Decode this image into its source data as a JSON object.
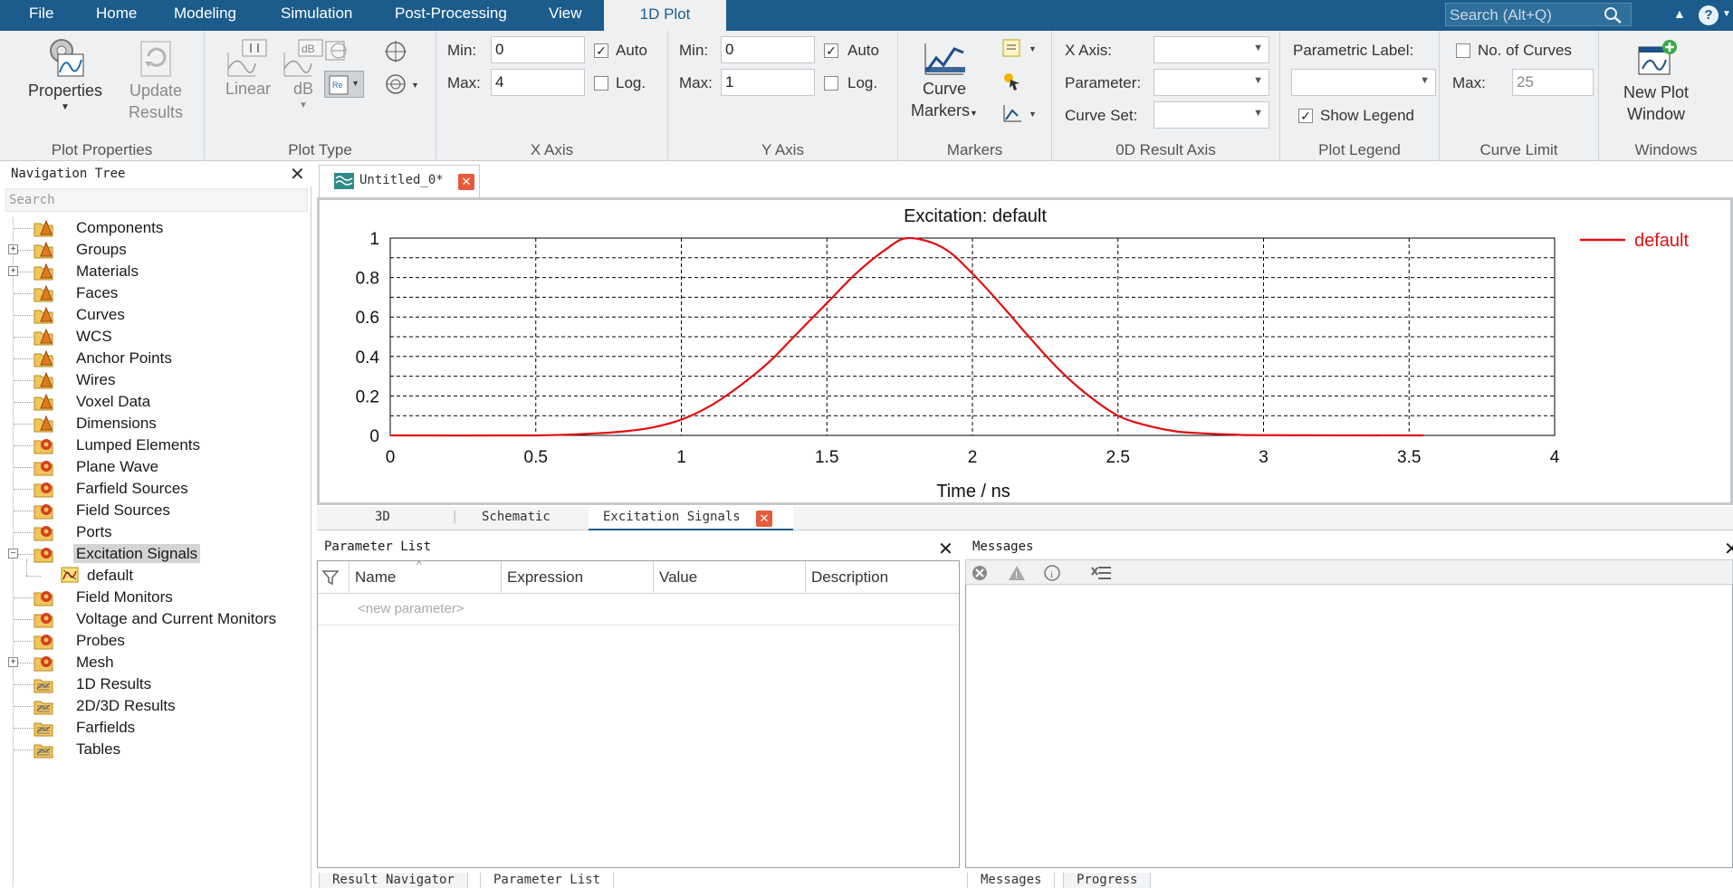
{
  "menu": {
    "tabs": [
      {
        "label": "File"
      },
      {
        "label": "Home"
      },
      {
        "label": "Modeling"
      },
      {
        "label": "Simulation"
      },
      {
        "label": "Post-Processing"
      },
      {
        "label": "View"
      },
      {
        "label": "1D Plot"
      }
    ],
    "active_tab": "1D Plot",
    "search_placeholder": "Search (Alt+Q)"
  },
  "ribbon": {
    "plot_properties": {
      "label": "Plot Properties",
      "properties_button": "Properties",
      "update_results_button_line1": "Update",
      "update_results_button_line2": "Results"
    },
    "plot_type": {
      "label": "Plot Type",
      "linear": "Linear",
      "db": "dB"
    },
    "x_axis": {
      "label": "X Axis",
      "min_label": "Min:",
      "min_value": "0",
      "max_label": "Max:",
      "max_value": "4",
      "auto_label": "Auto",
      "auto_checked": true,
      "log_label": "Log.",
      "log_checked": false
    },
    "y_axis": {
      "label": "Y Axis",
      "min_label": "Min:",
      "min_value": "0",
      "max_label": "Max:",
      "max_value": "1",
      "auto_label": "Auto",
      "auto_checked": true,
      "log_label": "Log.",
      "log_checked": false
    },
    "markers": {
      "label": "Markers",
      "curve_markers_line1": "Curve",
      "curve_markers_line2": "Markers"
    },
    "result_axis": {
      "label": "0D Result Axis",
      "x_axis_label": "X Axis:",
      "parameter_label": "Parameter:",
      "curve_set_label": "Curve Set:"
    },
    "plot_legend": {
      "label": "Plot Legend",
      "parametric_label": "Parametric Label:",
      "show_legend_label": "Show Legend",
      "show_legend_checked": true
    },
    "curve_limit": {
      "label": "Curve Limit",
      "no_of_curves_label": "No. of Curves",
      "no_of_curves_checked": false,
      "max_label": "Max:",
      "max_value": "25"
    },
    "windows": {
      "label": "Windows",
      "new_plot_window_line1": "New Plot",
      "new_plot_window_line2": "Window"
    }
  },
  "nav": {
    "title": "Navigation Tree",
    "search_placeholder": "Search",
    "items": [
      {
        "label": "Components",
        "expandable": false,
        "icon": "folder-cone-icon"
      },
      {
        "label": "Groups",
        "expandable": true,
        "icon": "folder-cone-icon"
      },
      {
        "label": "Materials",
        "expandable": true,
        "icon": "folder-cone-icon"
      },
      {
        "label": "Faces",
        "expandable": false,
        "icon": "folder-cone-icon"
      },
      {
        "label": "Curves",
        "expandable": false,
        "icon": "folder-cone-icon"
      },
      {
        "label": "WCS",
        "expandable": false,
        "icon": "folder-cone-icon"
      },
      {
        "label": "Anchor Points",
        "expandable": false,
        "icon": "folder-cone-icon"
      },
      {
        "label": "Wires",
        "expandable": false,
        "icon": "folder-cone-icon"
      },
      {
        "label": "Voxel Data",
        "expandable": false,
        "icon": "folder-cone-icon"
      },
      {
        "label": "Dimensions",
        "expandable": false,
        "icon": "folder-cone-icon"
      },
      {
        "label": "Lumped Elements",
        "expandable": false,
        "icon": "folder-gear-icon"
      },
      {
        "label": "Plane Wave",
        "expandable": false,
        "icon": "folder-gear-icon"
      },
      {
        "label": "Farfield Sources",
        "expandable": false,
        "icon": "folder-gear-icon"
      },
      {
        "label": "Field Sources",
        "expandable": false,
        "icon": "folder-gear-icon"
      },
      {
        "label": "Ports",
        "expandable": false,
        "icon": "folder-gear-icon"
      },
      {
        "label": "Excitation Signals",
        "expandable": true,
        "expanded": true,
        "selected": true,
        "icon": "folder-gear-icon"
      },
      {
        "label": "default",
        "child": true,
        "icon": "signal-icon"
      },
      {
        "label": "Field Monitors",
        "expandable": false,
        "icon": "folder-gear-icon"
      },
      {
        "label": "Voltage and Current Monitors",
        "expandable": false,
        "icon": "folder-gear-icon"
      },
      {
        "label": "Probes",
        "expandable": false,
        "icon": "folder-gear-icon"
      },
      {
        "label": "Mesh",
        "expandable": true,
        "icon": "folder-gear-icon"
      },
      {
        "label": "1D Results",
        "expandable": false,
        "icon": "folder-results-icon"
      },
      {
        "label": "2D/3D Results",
        "expandable": false,
        "icon": "folder-results-icon"
      },
      {
        "label": "Farfields",
        "expandable": false,
        "icon": "folder-results-icon"
      },
      {
        "label": "Tables",
        "expandable": false,
        "icon": "folder-results-icon"
      }
    ]
  },
  "document": {
    "tab_title": "Untitled_0*"
  },
  "chart_data": {
    "type": "line",
    "title": "Excitation: default",
    "xlabel": "Time / ns",
    "ylabel": "",
    "xlim": [
      0,
      4
    ],
    "ylim": [
      0,
      1
    ],
    "x_ticks": [
      "0",
      "0.5",
      "1",
      "1.5",
      "2",
      "2.5",
      "3",
      "3.5",
      "4"
    ],
    "y_ticks": [
      "0",
      "0.2",
      "0.4",
      "0.6",
      "0.8",
      "1"
    ],
    "grid": true,
    "legend_position": "right",
    "series": [
      {
        "name": "default",
        "color": "#e01010",
        "x": [
          0,
          0.5,
          0.7,
          0.8,
          0.9,
          1.0,
          1.1,
          1.2,
          1.3,
          1.4,
          1.5,
          1.6,
          1.7,
          1.78,
          1.9,
          2.0,
          2.1,
          2.2,
          2.3,
          2.4,
          2.5,
          2.6,
          2.7,
          2.8,
          2.9,
          3.0,
          3.55
        ],
        "y": [
          0,
          0,
          0.01,
          0.02,
          0.04,
          0.08,
          0.15,
          0.25,
          0.37,
          0.52,
          0.67,
          0.82,
          0.94,
          1.0,
          0.95,
          0.82,
          0.66,
          0.49,
          0.33,
          0.2,
          0.1,
          0.05,
          0.02,
          0.01,
          0.004,
          0.001,
          0
        ]
      }
    ]
  },
  "view_tabs": [
    {
      "label": "3D"
    },
    {
      "label": "Schematic"
    },
    {
      "label": "Excitation Signals"
    }
  ],
  "param_list": {
    "title": "Parameter List",
    "columns": [
      "Name",
      "Expression",
      "Value",
      "Description"
    ],
    "new_parameter_placeholder": "<new parameter>"
  },
  "messages": {
    "title": "Messages"
  },
  "bottom_tabs_left": [
    {
      "label": "Result Navigator"
    },
    {
      "label": "Parameter List"
    }
  ],
  "bottom_tabs_right": [
    {
      "label": "Messages"
    },
    {
      "label": "Progress"
    }
  ]
}
